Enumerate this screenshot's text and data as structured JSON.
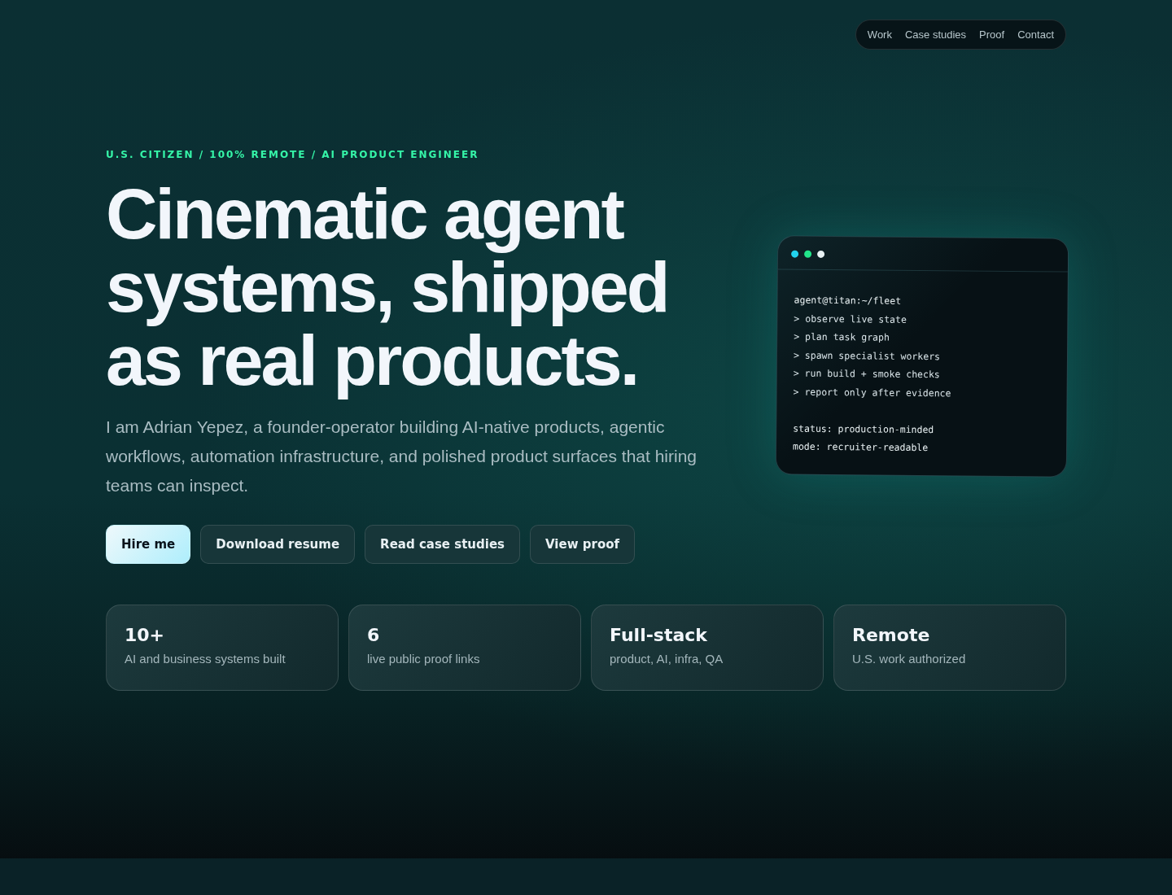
{
  "nav": {
    "links": [
      "Work",
      "Case studies",
      "Proof",
      "Contact"
    ]
  },
  "hero": {
    "eyebrow": "U.S. CITIZEN / 100% REMOTE / AI PRODUCT ENGINEER",
    "headline": [
      "Cinematic agent",
      "systems, shipped",
      "as real products."
    ],
    "intro": "I am Adrian Yepez, a founder-operator building AI-native products, agentic workflows, automation infrastructure, and polished product surfaces that hiring teams can inspect.",
    "buttons": [
      {
        "label": "Hire me",
        "kind": "primary"
      },
      {
        "label": "Download resume",
        "kind": "secondary"
      },
      {
        "label": "Read case studies",
        "kind": "secondary"
      },
      {
        "label": "View proof",
        "kind": "secondary"
      }
    ]
  },
  "terminal": {
    "dots": [
      {
        "color": "#22d3ee"
      },
      {
        "color": "#22e58a"
      },
      {
        "color": "#e8f2f4"
      }
    ],
    "lines": [
      {
        "text": "agent@titan:~/fleet",
        "kind": "plain"
      },
      {
        "text": "> observe live state",
        "kind": "command"
      },
      {
        "text": "> plan task graph",
        "kind": "command"
      },
      {
        "text": "> spawn specialist workers",
        "kind": "command"
      },
      {
        "text": "> run build + smoke checks",
        "kind": "command"
      },
      {
        "text": "> report only after evidence",
        "kind": "command"
      },
      {
        "text": "status: production-minded",
        "kind": "status"
      },
      {
        "text": "mode: recruiter-readable",
        "kind": "plain"
      }
    ]
  },
  "stats": [
    {
      "value": "10+",
      "label": "AI and business systems built"
    },
    {
      "value": "6",
      "label": "live public proof links"
    },
    {
      "value": "Full-stack",
      "label": "product, AI, infra, QA"
    },
    {
      "value": "Remote",
      "label": "U.S. work authorized"
    }
  ]
}
